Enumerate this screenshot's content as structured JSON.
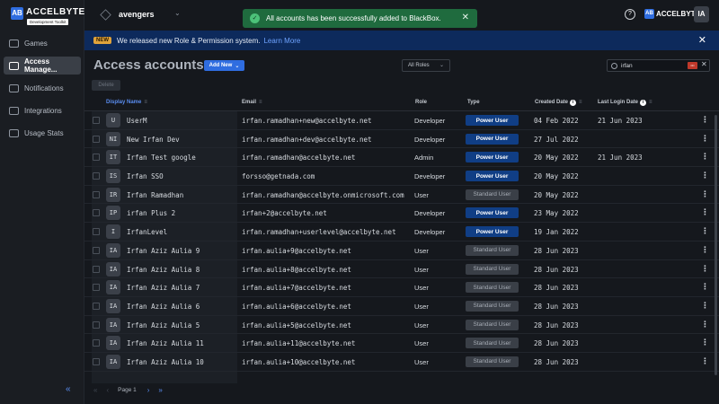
{
  "brand": {
    "name": "ACCELBYTE",
    "subtitle": "Development Toolkit",
    "mark": "AB"
  },
  "sidebar": {
    "items": [
      {
        "label": "Games",
        "icon": "controller-icon",
        "active": false
      },
      {
        "label": "Access Manage...",
        "icon": "key-icon",
        "active": true
      },
      {
        "label": "Notifications",
        "icon": "chat-icon",
        "active": false
      },
      {
        "label": "Integrations",
        "icon": "plug-icon",
        "active": false
      },
      {
        "label": "Usage Stats",
        "icon": "layers-icon",
        "active": false
      }
    ],
    "collapse_glyph": "«"
  },
  "topbar": {
    "project": "avengers",
    "brand_short": "ACCELBYTE",
    "avatar": "IA"
  },
  "toast": {
    "message": "All accounts has been successfully added to BlackBox."
  },
  "banner": {
    "badge": "NEW",
    "text": "We released new Role & Permission system.",
    "link": "Learn More"
  },
  "header": {
    "title": "Access accounts",
    "add_new": "Add New",
    "roles_filter": "All Roles",
    "search_value": "irfan",
    "delete": "Delete"
  },
  "table": {
    "columns": {
      "display_name": "Display Name",
      "email": "Email",
      "role": "Role",
      "type": "Type",
      "created": "Created Date",
      "last_login": "Last Login Date"
    },
    "rows": [
      {
        "initials": "U",
        "name": "UserM",
        "email": "irfan.ramadhan+new@accelbyte.net",
        "role": "Developer",
        "type": "Power User",
        "created": "04 Feb 2022",
        "last_login": "21 Jun 2023"
      },
      {
        "initials": "NI",
        "name": "New Irfan Dev",
        "email": "irfan.ramadhan+dev@accelbyte.net",
        "role": "Developer",
        "type": "Power User",
        "created": "27 Jul 2022",
        "last_login": ""
      },
      {
        "initials": "IT",
        "name": "Irfan Test google",
        "email": "irfan.ramadhan@accelbyte.net",
        "role": "Admin",
        "type": "Power User",
        "created": "20 May 2022",
        "last_login": "21 Jun 2023"
      },
      {
        "initials": "IS",
        "name": "Irfan SSO",
        "email": "forsso@getnada.com",
        "role": "Developer",
        "type": "Power User",
        "created": "20 May 2022",
        "last_login": ""
      },
      {
        "initials": "IR",
        "name": "Irfan Ramadhan",
        "email": "irfan.ramadhan@accelbyte.onmicrosoft.com",
        "role": "User",
        "type": "Standard User",
        "created": "20 May 2022",
        "last_login": ""
      },
      {
        "initials": "IP",
        "name": "irfan Plus 2",
        "email": "irfan+2@accelbyte.net",
        "role": "Developer",
        "type": "Power User",
        "created": "23 May 2022",
        "last_login": ""
      },
      {
        "initials": "I",
        "name": "IrfanLevel",
        "email": "irfan.ramadhan+userlevel@accelbyte.net",
        "role": "Developer",
        "type": "Power User",
        "created": "19 Jan 2022",
        "last_login": ""
      },
      {
        "initials": "IA",
        "name": "Irfan Aziz Aulia 9",
        "email": "irfan.aulia+9@accelbyte.net",
        "role": "User",
        "type": "Standard User",
        "created": "28 Jun 2023",
        "last_login": ""
      },
      {
        "initials": "IA",
        "name": "Irfan Aziz Aulia 8",
        "email": "irfan.aulia+8@accelbyte.net",
        "role": "User",
        "type": "Standard User",
        "created": "28 Jun 2023",
        "last_login": ""
      },
      {
        "initials": "IA",
        "name": "Irfan Aziz Aulia 7",
        "email": "irfan.aulia+7@accelbyte.net",
        "role": "User",
        "type": "Standard User",
        "created": "28 Jun 2023",
        "last_login": ""
      },
      {
        "initials": "IA",
        "name": "Irfan Aziz Aulia 6",
        "email": "irfan.aulia+6@accelbyte.net",
        "role": "User",
        "type": "Standard User",
        "created": "28 Jun 2023",
        "last_login": ""
      },
      {
        "initials": "IA",
        "name": "Irfan Aziz Aulia 5",
        "email": "irfan.aulia+5@accelbyte.net",
        "role": "User",
        "type": "Standard User",
        "created": "28 Jun 2023",
        "last_login": ""
      },
      {
        "initials": "IA",
        "name": "Irfan Aziz Aulia 11",
        "email": "irfan.aulia+11@accelbyte.net",
        "role": "User",
        "type": "Standard User",
        "created": "28 Jun 2023",
        "last_login": ""
      },
      {
        "initials": "IA",
        "name": "Irfan Aziz Aulia 10",
        "email": "irfan.aulia+10@accelbyte.net",
        "role": "User",
        "type": "Standard User",
        "created": "28 Jun 2023",
        "last_login": ""
      }
    ]
  },
  "pagination": {
    "page_label": "Page 1"
  },
  "colors": {
    "accent": "#2f6de0",
    "power_user": "#103e85",
    "toast": "#1f6b3e",
    "banner": "#0d2a5c"
  }
}
